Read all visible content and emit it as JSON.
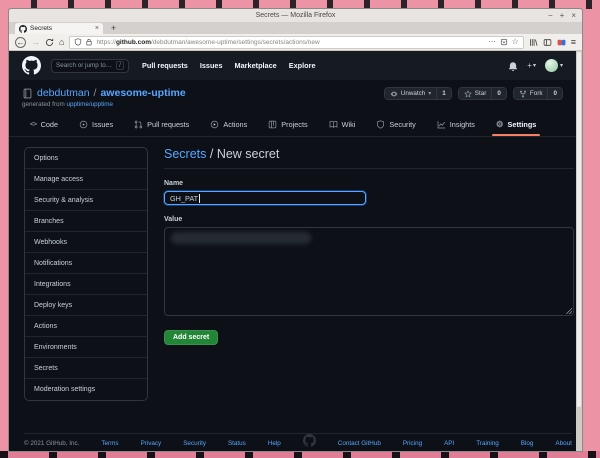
{
  "glyphs": {
    "back": "←",
    "forward": "→",
    "home": "⌂",
    "more": "⋯",
    "star": "☆",
    "caret": "▾",
    "menu": "≡",
    "min": "−",
    "max": "+",
    "close": "×",
    "plus": "+",
    "slash": "/",
    "code_brackets": "<>",
    "gear": "⚙",
    "new_tab": "+",
    "tab_close": "×"
  },
  "browser": {
    "title": "Secrets — Mozilla Firefox",
    "tab_label": "Secrets",
    "url_scheme": "https://",
    "url_domain": "github.com",
    "url_path": "/debdutman/awesome-uptime/settings/secrets/actions/new"
  },
  "github": {
    "nav": {
      "search_placeholder": "Search or jump to…",
      "links": [
        "Pull requests",
        "Issues",
        "Marketplace",
        "Explore"
      ]
    },
    "repo": {
      "owner": "debdutman",
      "separator": "/",
      "name": "awesome-uptime",
      "generated_prefix": "generated from ",
      "generated_link": "upptime/upptime",
      "watch_label": "Unwatch",
      "watch_count": "1",
      "star_label": "Star",
      "star_count": "0",
      "fork_label": "Fork",
      "fork_count": "0"
    },
    "tabs": {
      "code": "Code",
      "issues": "Issues",
      "pulls": "Pull requests",
      "actions": "Actions",
      "projects": "Projects",
      "wiki": "Wiki",
      "security": "Security",
      "insights": "Insights",
      "settings": "Settings"
    },
    "sidebar": {
      "items": [
        "Options",
        "Manage access",
        "Security & analysis",
        "Branches",
        "Webhooks",
        "Notifications",
        "Integrations",
        "Deploy keys",
        "Actions",
        "Environments",
        "Secrets",
        "Moderation settings"
      ]
    },
    "content": {
      "breadcrumb_link": "Secrets",
      "breadcrumb_sep": " / ",
      "breadcrumb_current": "New secret",
      "name_label": "Name",
      "name_value": "GH_PAT",
      "value_label": "Value",
      "submit_label": "Add secret"
    },
    "footer": {
      "copyright": "© 2021 GitHub, Inc.",
      "links": [
        "Terms",
        "Privacy",
        "Security",
        "Status",
        "Help",
        "Contact GitHub",
        "Pricing",
        "API",
        "Training",
        "Blog",
        "About"
      ]
    }
  },
  "colors": {
    "accent_green": "#238636",
    "link_blue": "#58a6ff",
    "settings_underline": "#f78166",
    "page_bg": "#0d1117",
    "header_bg": "#161b22",
    "desktop_pink": "#ec93a5"
  }
}
